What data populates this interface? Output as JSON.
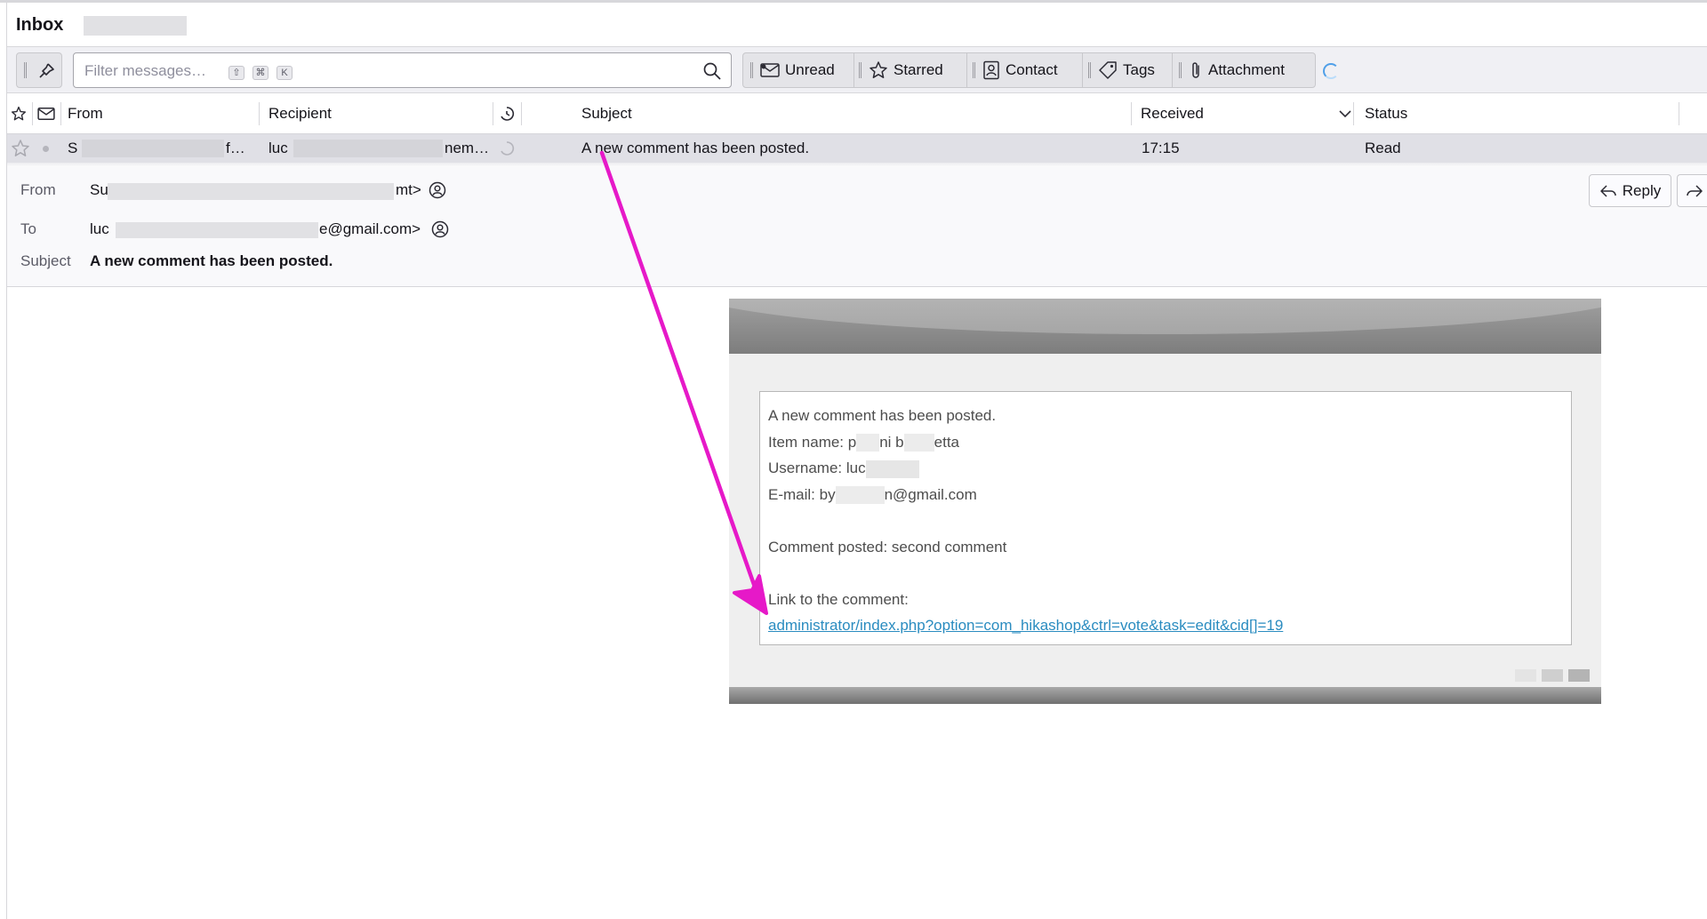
{
  "header": {
    "title": "Inbox"
  },
  "quick_filter": {
    "placeholder": "Filter messages…",
    "shortcut_keys": [
      "⇧",
      "⌘",
      "K"
    ],
    "buttons": [
      {
        "label": "Unread",
        "icon": "unread-icon"
      },
      {
        "label": "Starred",
        "icon": "star-icon"
      },
      {
        "label": "Contact",
        "icon": "contact-icon"
      },
      {
        "label": "Tags",
        "icon": "tag-icon"
      },
      {
        "label": "Attachment",
        "icon": "attachment-icon"
      }
    ]
  },
  "columns": {
    "from": "From",
    "recipient": "Recipient",
    "subject": "Subject",
    "received": "Received",
    "status": "Status"
  },
  "message_row": {
    "from": "S",
    "from_tail": "f…",
    "recipient": "luc",
    "recipient_tail": "nem…",
    "subject": "A new comment has been posted.",
    "received": "17:15",
    "status": "Read"
  },
  "message_header": {
    "from_label": "From",
    "from_value_start": "Su",
    "from_value_end": "mt>",
    "to_label": "To",
    "to_value_start": "luc",
    "to_value_end": "e@gmail.com>",
    "subject_label": "Subject",
    "subject_value": "A new comment has been posted.",
    "reply_label": "Reply"
  },
  "email_body": {
    "line1": "A new comment has been posted.",
    "item_name_prefix": "Item name: p",
    "item_name_mid": "ni b",
    "item_name_end": "etta",
    "username_prefix": "Username: luc",
    "email_prefix": "E-mail: by",
    "email_end": "n@gmail.com",
    "comment": "Comment posted: second comment",
    "link_label": "Link to the comment:",
    "link": "administrator/index.php?option=com_hikashop&ctrl=vote&task=edit&cid[]=19"
  },
  "colors": {
    "annotation_arrow": "#e619c8",
    "link": "#2a8cc0",
    "selected_row": "#e0e0e6"
  }
}
